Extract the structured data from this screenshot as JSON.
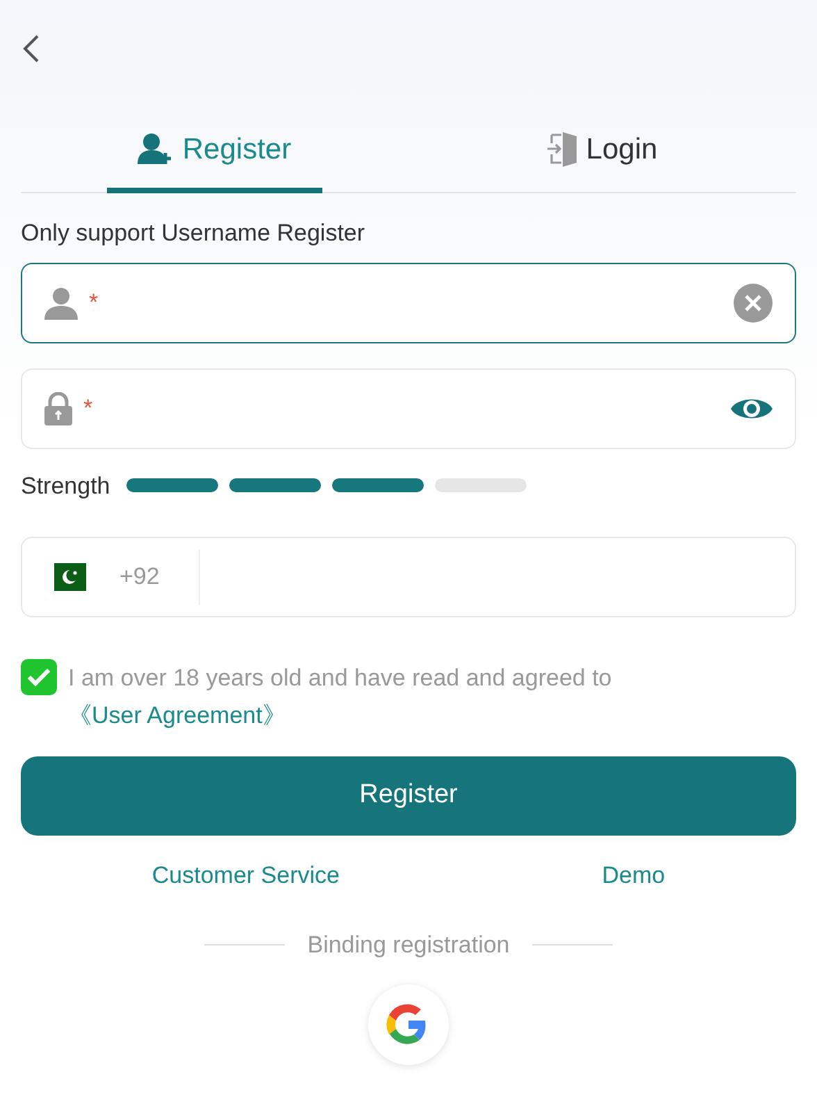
{
  "tabs": [
    {
      "label": "Register",
      "kind": "register",
      "selected": true
    },
    {
      "label": "Login",
      "kind": "login",
      "selected": false
    }
  ],
  "notice": "Only support Username Register",
  "username_field": {
    "marker": "*",
    "clear_button": true
  },
  "password_field": {
    "marker": "*",
    "reveal_button": true
  },
  "strength": {
    "label": "Strength",
    "level": 0.75
  },
  "phone_field": {
    "country_code": "+92"
  },
  "agreement": {
    "checked": true,
    "text": "I am over 18 years old and have read and agreed to",
    "link": "《User Agreement》"
  },
  "submit_button": "Register",
  "links": [
    "Customer Service",
    "Demo"
  ],
  "binding": {
    "label": "Binding registration",
    "providers": [
      {
        "kind": "google"
      }
    ]
  }
}
